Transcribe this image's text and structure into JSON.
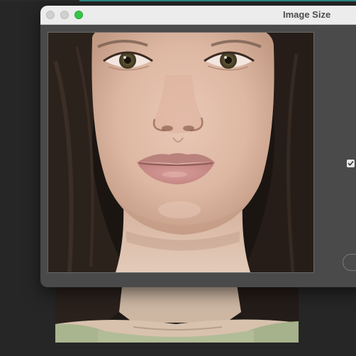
{
  "window": {
    "title": "Image Size",
    "controls": {
      "close": "close-button",
      "minimize": "minimize-button",
      "zoom": "zoom-button"
    }
  },
  "preview": {
    "icon": "portrait-photo",
    "kind": "woman face close-up"
  },
  "options": {
    "constrain_checkbox_checked": true
  },
  "colors": {
    "dialog_bg": "#4a4a4a",
    "titlebar_bg": "#ececec",
    "zoom_button": "#33c648",
    "accent_line": "#2c8a87",
    "workspace_bg": "#262626"
  }
}
